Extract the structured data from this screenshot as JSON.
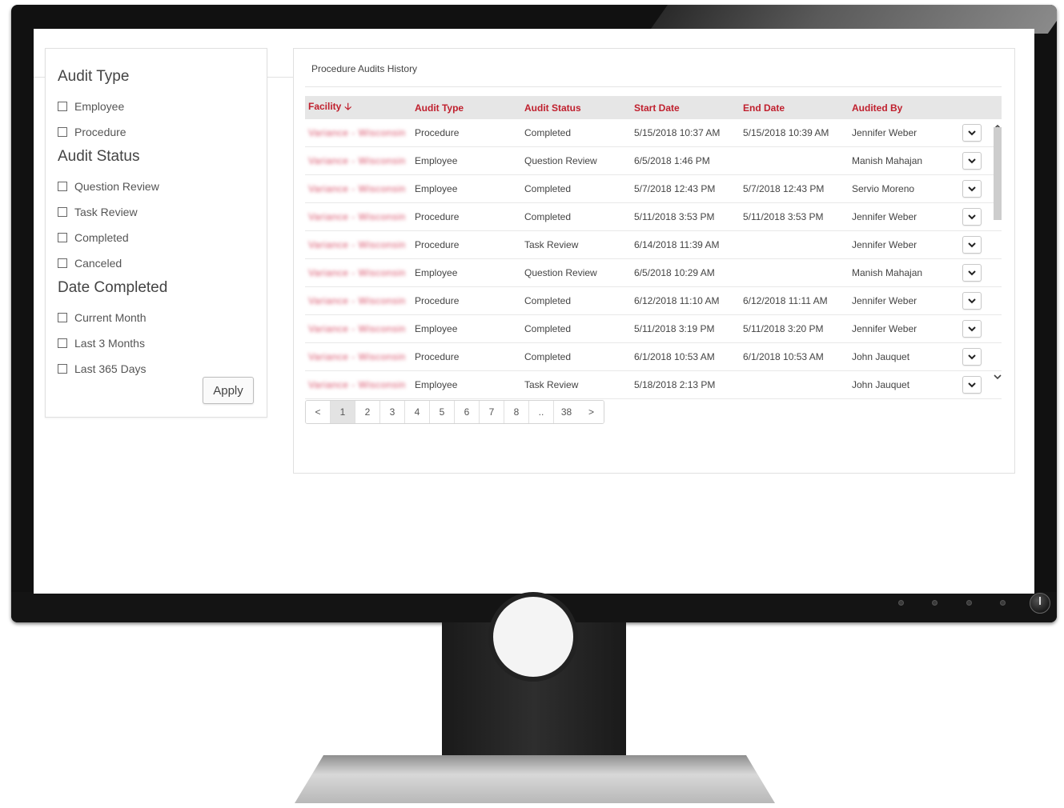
{
  "filters": {
    "audit_type": {
      "heading": "Audit Type",
      "options": [
        "Employee",
        "Procedure"
      ]
    },
    "audit_status": {
      "heading": "Audit Status",
      "options": [
        "Question Review",
        "Task Review",
        "Completed",
        "Canceled"
      ]
    },
    "date_completed": {
      "heading": "Date Completed",
      "options": [
        "Current Month",
        "Last 3 Months",
        "Last 365 Days"
      ]
    },
    "apply_label": "Apply"
  },
  "table": {
    "title": "Procedure Audits History",
    "columns": [
      "Facility",
      "Audit Type",
      "Audit Status",
      "Start Date",
      "End Date",
      "Audited By"
    ],
    "rows": [
      {
        "facility": "Variance - Wisconsin",
        "type": "Procedure",
        "status": "Completed",
        "start": "5/15/2018 10:37 AM",
        "end": "5/15/2018 10:39 AM",
        "by": "Jennifer Weber"
      },
      {
        "facility": "Variance - Wisconsin",
        "type": "Employee",
        "status": "Question Review",
        "start": "6/5/2018 1:46 PM",
        "end": "",
        "by": "Manish Mahajan"
      },
      {
        "facility": "Variance - Wisconsin",
        "type": "Employee",
        "status": "Completed",
        "start": "5/7/2018 12:43 PM",
        "end": "5/7/2018 12:43 PM",
        "by": "Servio Moreno"
      },
      {
        "facility": "Variance - Wisconsin",
        "type": "Procedure",
        "status": "Completed",
        "start": "5/11/2018 3:53 PM",
        "end": "5/11/2018 3:53 PM",
        "by": "Jennifer Weber"
      },
      {
        "facility": "Variance - Wisconsin",
        "type": "Procedure",
        "status": "Task Review",
        "start": "6/14/2018 11:39 AM",
        "end": "",
        "by": "Jennifer Weber"
      },
      {
        "facility": "Variance - Wisconsin",
        "type": "Employee",
        "status": "Question Review",
        "start": "6/5/2018 10:29 AM",
        "end": "",
        "by": "Manish Mahajan"
      },
      {
        "facility": "Variance - Wisconsin",
        "type": "Procedure",
        "status": "Completed",
        "start": "6/12/2018 11:10 AM",
        "end": "6/12/2018 11:11 AM",
        "by": "Jennifer Weber"
      },
      {
        "facility": "Variance - Wisconsin",
        "type": "Employee",
        "status": "Completed",
        "start": "5/11/2018 3:19 PM",
        "end": "5/11/2018 3:20 PM",
        "by": "Jennifer Weber"
      },
      {
        "facility": "Variance - Wisconsin",
        "type": "Procedure",
        "status": "Completed",
        "start": "6/1/2018 10:53 AM",
        "end": "6/1/2018 10:53 AM",
        "by": "John Jauquet"
      },
      {
        "facility": "Variance - Wisconsin",
        "type": "Employee",
        "status": "Task Review",
        "start": "5/18/2018 2:13 PM",
        "end": "",
        "by": "John Jauquet"
      }
    ]
  },
  "pagination": {
    "prev": "<",
    "pages": [
      "1",
      "2",
      "3",
      "4",
      "5",
      "6",
      "7",
      "8",
      "..",
      "38"
    ],
    "next": ">",
    "current": "1"
  },
  "colors": {
    "accent": "#c0202e",
    "header_bg": "#e6e6e6"
  }
}
